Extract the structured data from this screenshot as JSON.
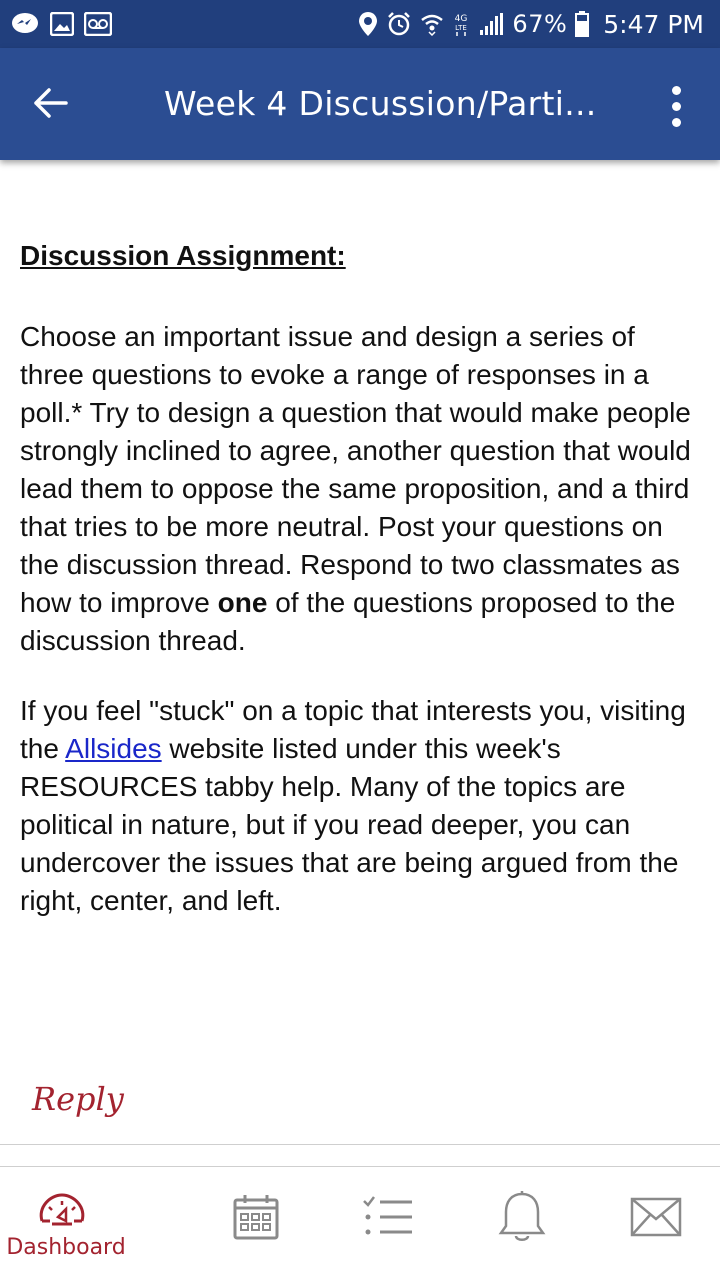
{
  "status_bar": {
    "battery_percent": "67%",
    "time": "5:47 PM",
    "network_type": "4G LTE",
    "icons": [
      "messenger-icon",
      "gallery-icon",
      "voicemail-icon",
      "location-icon",
      "alarm-icon",
      "wifi-icon",
      "network-icon",
      "signal-icon",
      "battery-icon"
    ]
  },
  "app_bar": {
    "title": "Week 4 Discussion/Parti...",
    "back_icon": "arrow-left-icon",
    "menu_icon": "more-vertical-icon",
    "background_color": "#2b4d92"
  },
  "content": {
    "heading": "Discussion Assignment:",
    "paragraph1": {
      "before_bold": "Choose an important issue and design a series of three questions to evoke a range of responses in a poll.* Try to design a question that would make people strongly inclined to agree, another question that would lead them to oppose the same proposition, and a third that tries to be more neutral. Post your questions on the discussion thread.  Respond to two classmates as how to improve ",
      "bold": "one",
      "after_bold": " of the questions proposed to the discussion thread."
    },
    "paragraph2": {
      "before_link": "If you feel \"stuck\" on a topic that interests you, visiting the ",
      "link": "Allsides",
      "after_link": " website listed under this week's RESOURCES tabby help. Many of the topics are political in nature, but if you read deeper, you can undercover the issues that are being argued from the right, center, and left."
    },
    "link_color": "#1a27c9"
  },
  "reply": {
    "label": "Reply",
    "color": "#a3232f"
  },
  "bottom_nav": {
    "items": [
      {
        "label": "Dashboard",
        "icon": "dashboard-icon",
        "active": true
      },
      {
        "label": "",
        "icon": "calendar-icon",
        "active": false
      },
      {
        "label": "",
        "icon": "todo-list-icon",
        "active": false
      },
      {
        "label": "",
        "icon": "notifications-bell-icon",
        "active": false
      },
      {
        "label": "",
        "icon": "inbox-envelope-icon",
        "active": false
      }
    ],
    "active_color": "#a3232f",
    "inactive_color": "#8a8a8a"
  }
}
